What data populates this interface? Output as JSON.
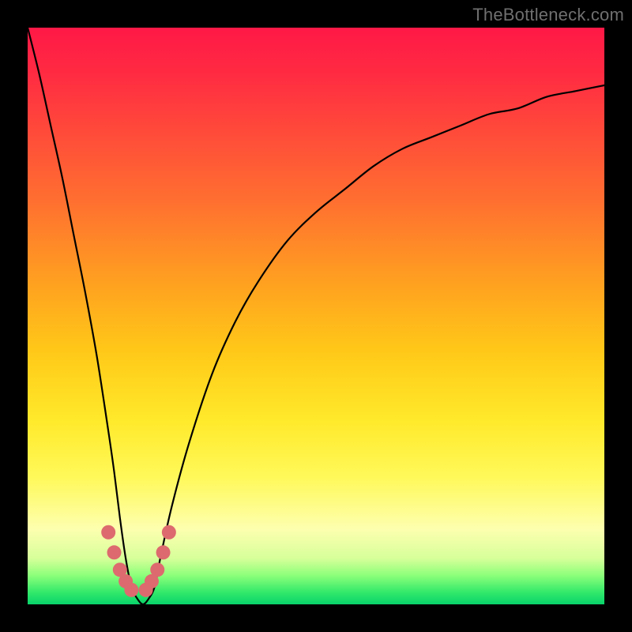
{
  "watermark": {
    "text": "TheBottleneck.com"
  },
  "chart_data": {
    "type": "line",
    "title": "",
    "xlabel": "",
    "ylabel": "",
    "xlim": [
      0,
      100
    ],
    "ylim": [
      0,
      100
    ],
    "grid": false,
    "legend": false,
    "series": [
      {
        "name": "bottleneck-curve",
        "x": [
          0,
          2,
          4,
          6,
          8,
          10,
          12,
          14,
          15,
          16,
          17,
          18,
          19,
          20,
          21,
          22,
          23,
          25,
          28,
          32,
          36,
          40,
          45,
          50,
          55,
          60,
          65,
          70,
          75,
          80,
          85,
          90,
          95,
          100
        ],
        "values": [
          100,
          92,
          83,
          74,
          64,
          54,
          43,
          30,
          23,
          15,
          8,
          3,
          1,
          0,
          1,
          3,
          8,
          17,
          28,
          40,
          49,
          56,
          63,
          68,
          72,
          76,
          79,
          81,
          83,
          85,
          86,
          88,
          89,
          90
        ]
      }
    ],
    "markers": {
      "name": "valley-dots",
      "color": "#dd6a6e",
      "x": [
        14.0,
        15.0,
        16.0,
        17.0,
        18.0,
        20.5,
        21.5,
        22.5,
        23.5,
        24.5
      ],
      "values": [
        12.5,
        9.0,
        6.0,
        4.0,
        2.5,
        2.5,
        4.0,
        6.0,
        9.0,
        12.5
      ]
    },
    "background_gradient": {
      "stops": [
        {
          "pos": 0,
          "color": "#ff1846"
        },
        {
          "pos": 45,
          "color": "#ffa31f"
        },
        {
          "pos": 78,
          "color": "#fff95a"
        },
        {
          "pos": 100,
          "color": "#09d36a"
        }
      ]
    }
  }
}
